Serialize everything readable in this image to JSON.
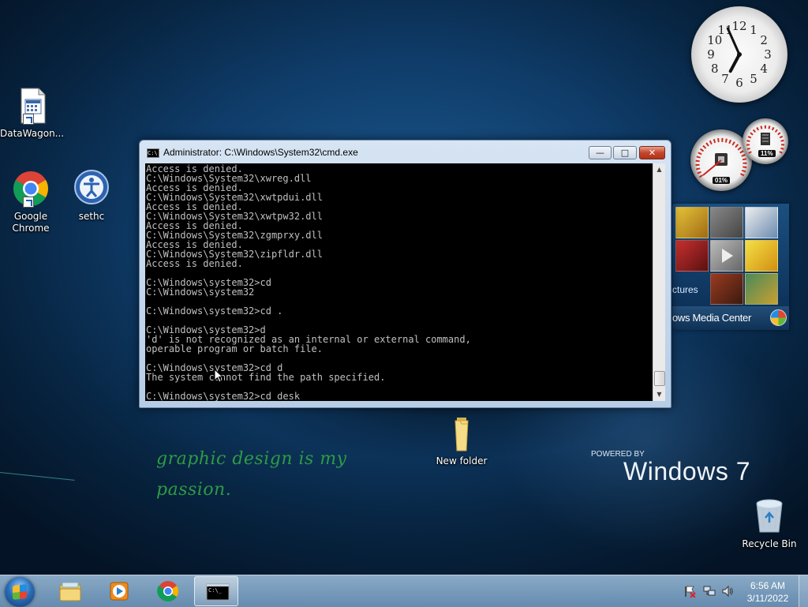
{
  "desktop": {
    "icons": [
      {
        "label": "DataWagon...",
        "icon": "datawagon-document-icon"
      },
      {
        "label": "Google Chrome",
        "icon": "chrome-icon"
      },
      {
        "label": "sethc",
        "icon": "sethc-icon"
      },
      {
        "label": "New folder",
        "icon": "folder-icon"
      },
      {
        "label": "Recycle Bin",
        "icon": "recycle-bin-icon"
      }
    ],
    "wallpaper": {
      "tagline_line1": "graphic design is my",
      "tagline_line2": "passion.",
      "powered_by": "POWERED BY",
      "os_name": "Windows 7"
    }
  },
  "cmd_window": {
    "title": "Administrator: C:\\Windows\\System32\\cmd.exe",
    "title_icon_text": "C:\\",
    "buttons": {
      "minimize": "—",
      "maximize": "□",
      "close": "✕"
    },
    "console_text": "Access is denied.\nC:\\Windows\\System32\\xwreg.dll\nAccess is denied.\nC:\\Windows\\System32\\xwtpdui.dll\nAccess is denied.\nC:\\Windows\\System32\\xwtpw32.dll\nAccess is denied.\nC:\\Windows\\System32\\zgmprxy.dll\nAccess is denied.\nC:\\Windows\\System32\\zipfldr.dll\nAccess is denied.\n\nC:\\Windows\\system32>cd\nC:\\Windows\\system32\n\nC:\\Windows\\system32>cd .\n\nC:\\Windows\\system32>d\n'd' is not recognized as an internal or external command,\noperable program or batch file.\n\nC:\\Windows\\system32>cd d\nThe system cannot find the path specified.\n\nC:\\Windows\\system32>cd desk"
  },
  "gadgets": {
    "clock": {
      "numerals": [
        "12",
        "1",
        "2",
        "3",
        "4",
        "5",
        "6",
        "7",
        "8",
        "9",
        "10",
        "11"
      ],
      "hour": 6,
      "minute": 56
    },
    "cpu_meter": {
      "cpu_readout": "01%",
      "memory_readout": "11%"
    },
    "media_center": {
      "tile_label": "ctures",
      "bar_text": "ows Media Center"
    }
  },
  "taskbar": {
    "pinned": [
      {
        "name": "windows-explorer",
        "icon": "explorer-folder-icon"
      },
      {
        "name": "windows-media-player",
        "icon": "media-player-icon"
      },
      {
        "name": "google-chrome",
        "icon": "chrome-icon"
      },
      {
        "name": "command-prompt",
        "icon": "cmd-icon",
        "active": true
      }
    ],
    "cmd_icon_text": "C:\\_",
    "tray": {
      "icons": [
        "action-center-flag-icon",
        "network-icon",
        "volume-icon"
      ]
    },
    "time": "6:56 AM",
    "date": "3/11/2022"
  },
  "colors": {
    "tagline": "#2e9b45",
    "console_bg": "#000000",
    "console_fg": "#c0c0c0"
  }
}
